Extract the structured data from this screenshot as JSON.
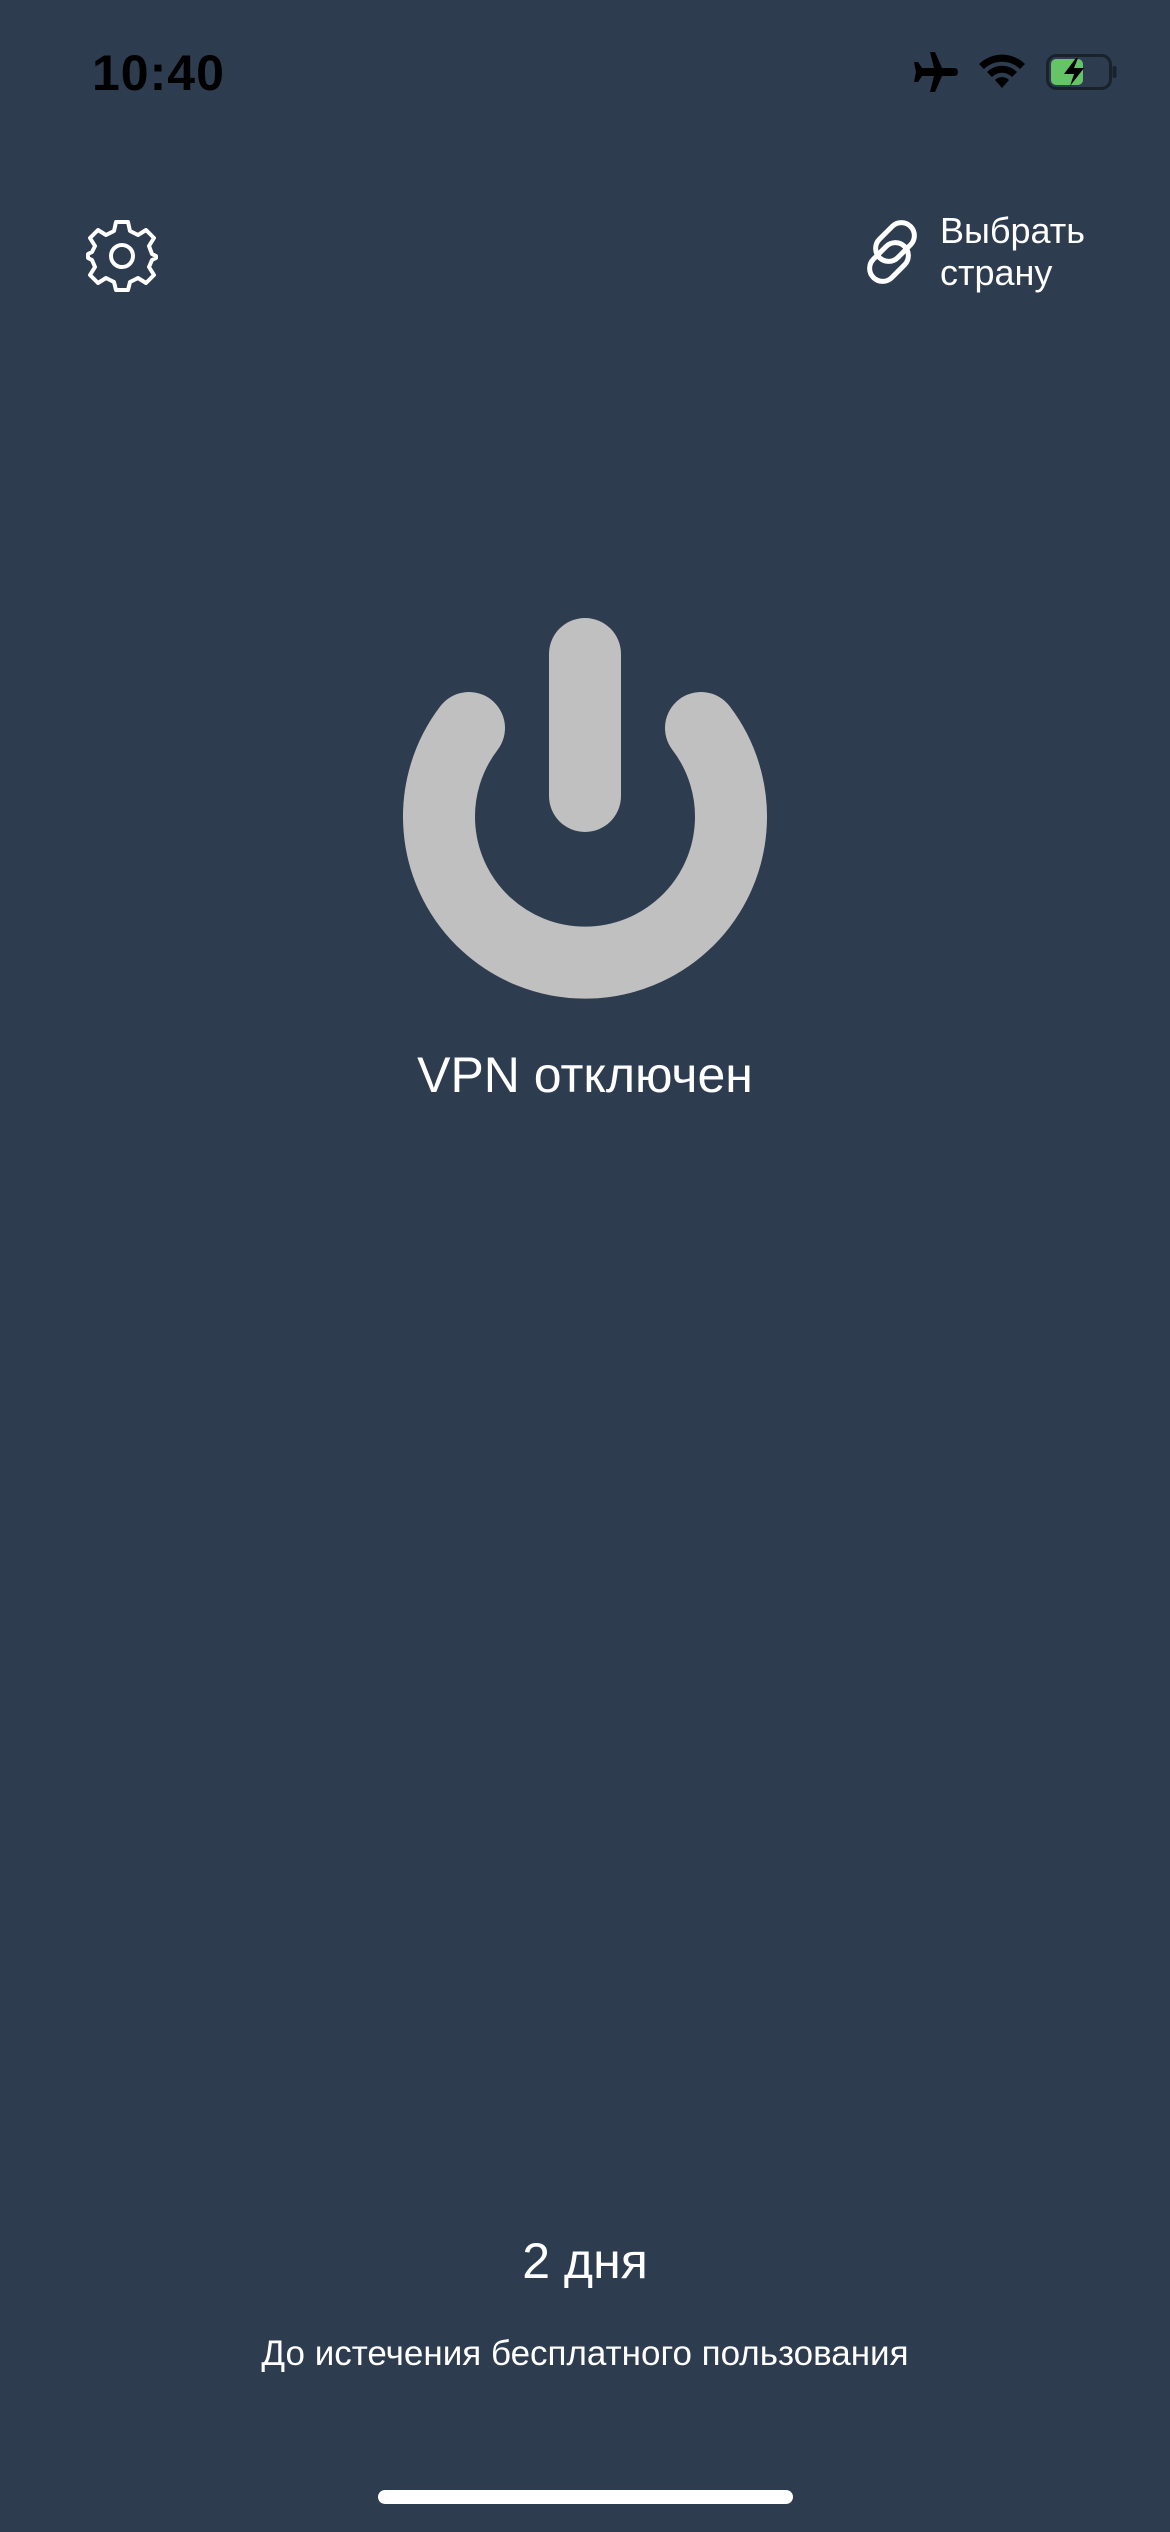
{
  "status_bar": {
    "time": "10:40",
    "icons": [
      "airplane-icon",
      "wifi-icon",
      "battery-charging-icon"
    ],
    "battery_color": "#65c466"
  },
  "header": {
    "settings_icon": "gear-icon",
    "country_icon": "link-icon",
    "country_label": "Выбрать страну"
  },
  "main": {
    "power_icon": "power-icon",
    "power_color": "#c0c0c0",
    "status_text": "VPN отключен"
  },
  "footer": {
    "days_left": "2 дня",
    "caption": "До истечения бесплатного пользования"
  },
  "theme": {
    "background": "#2e3c4f",
    "text": "#ffffff"
  }
}
